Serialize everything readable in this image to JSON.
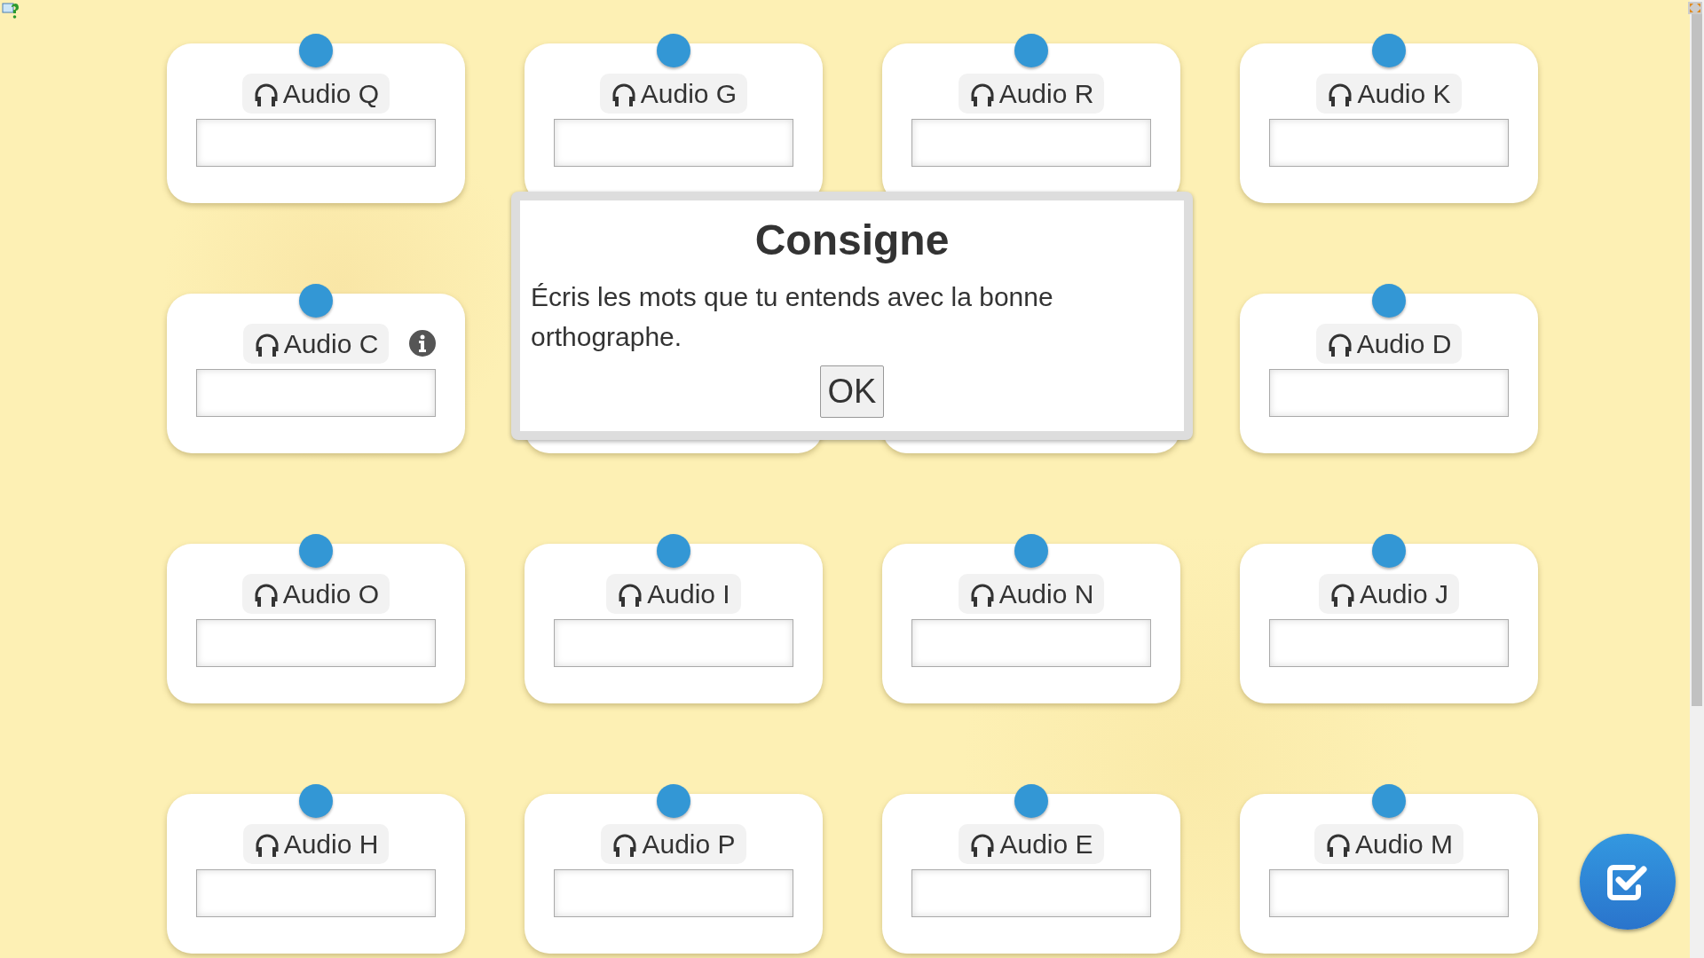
{
  "cards": [
    {
      "kind": "audio",
      "label": "Audio Q",
      "has_info": false
    },
    {
      "kind": "audio",
      "label": "Audio G",
      "has_info": false
    },
    {
      "kind": "audio",
      "label": "Audio R",
      "has_info": false
    },
    {
      "kind": "audio",
      "label": "Audio K",
      "has_info": false
    },
    {
      "kind": "audio",
      "label": "Audio C",
      "has_info": true
    },
    {
      "kind": "covered"
    },
    {
      "kind": "covered"
    },
    {
      "kind": "audio",
      "label": "Audio D",
      "has_info": false
    },
    {
      "kind": "audio",
      "label": "Audio O",
      "has_info": false
    },
    {
      "kind": "audio",
      "label": "Audio I",
      "has_info": false
    },
    {
      "kind": "audio",
      "label": "Audio N",
      "has_info": false
    },
    {
      "kind": "audio",
      "label": "Audio J",
      "has_info": false
    },
    {
      "kind": "audio",
      "label": "Audio H",
      "has_info": false
    },
    {
      "kind": "audio",
      "label": "Audio P",
      "has_info": false
    },
    {
      "kind": "audio",
      "label": "Audio E",
      "has_info": false
    },
    {
      "kind": "audio",
      "label": "Audio M",
      "has_info": false
    }
  ],
  "dialog": {
    "title": "Consigne",
    "text": "Écris les mots que tu entends avec la bonne orthographe.",
    "button": "OK"
  }
}
